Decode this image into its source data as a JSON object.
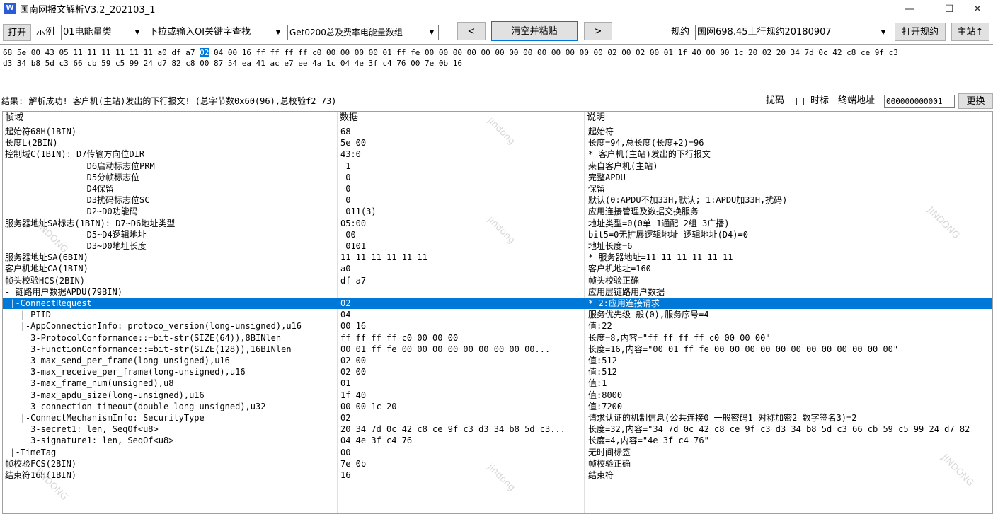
{
  "window": {
    "title": "国南网报文解析V3.2_202103_1",
    "icon": "app-logo-icon",
    "minimize_glyph": "—",
    "maximize_glyph": "☐",
    "close_glyph": "✕"
  },
  "toolbar": {
    "open_label": "打开",
    "example_label": "示例",
    "example_value": "01电能量类",
    "oi_value": "下拉或输入OI关键字查找",
    "get_value": "Get0200总及费率电能量数组",
    "prev_label": "<",
    "clear_paste_label": "清空并粘贴",
    "next_label": ">",
    "protocol_label": "规约",
    "protocol_value": "国网698.45上行规约20180907",
    "open_protocol_label": "打开规约",
    "master_label": "主站↑",
    "dropdown_glyph": "▼"
  },
  "hex": {
    "line1_pre": "68 5e 00 43 05 11 11 11 11 11 11 a0 df a7 ",
    "line1_sel": "02",
    "line1_post": " 04 00 16 ff ff ff ff c0 00 00 00 00 01 ff fe 00 00 00 00 00 00 00 00 00 00 00 00 00 02 00 02 00 01 1f 40 00 00 1c 20 02 20 34 7d 0c 42 c8 ce 9f c3",
    "line2": "d3 34 b8 5d c3 66 cb 59 c5 99 24 d7 82 c8 00 87 54 ea 41 ac e7 ee 4a 1c 04 4e 3f c4 76 00 7e 0b 16"
  },
  "result": {
    "text": "结果: 解析成功! 客户机(主站)发出的下行报文! (总字节数0x60(96),总校验f2 73)",
    "scramble_label": "扰码",
    "timetag_label": "时标",
    "terminal_addr_label": "终端地址",
    "terminal_addr_value": "000000000001",
    "change_label": "更换"
  },
  "table": {
    "headers": [
      "帧域",
      "数据",
      "说明"
    ],
    "selected_index": 15,
    "rows": [
      [
        "起始符68H(1BIN)",
        "68",
        "起始符"
      ],
      [
        "长度L(2BIN)",
        "5e 00",
        "长度=94,总长度(长度+2)=96"
      ],
      [
        "控制域C(1BIN): D7传输方向位DIR",
        "43:0",
        "* 客户机(主站)发出的下行报文"
      ],
      [
        "                D6启动标志位PRM",
        " 1",
        "来自客户机(主站)"
      ],
      [
        "                D5分帧标志位",
        " 0",
        "完整APDU"
      ],
      [
        "                D4保留",
        " 0",
        "保留"
      ],
      [
        "                D3扰码标志位SC",
        " 0",
        "默认(0:APDU不加33H,默认; 1:APDU加33H,扰码)"
      ],
      [
        "                D2~D0功能码",
        " 011(3)",
        "应用连接管理及数据交换服务"
      ],
      [
        "服务器地址SA标志(1BIN): D7~D6地址类型",
        "05:00",
        "地址类型=0(0单 1通配 2组 3广播)"
      ],
      [
        "                D5~D4逻辑地址",
        " 00",
        "bit5=0无扩展逻辑地址 逻辑地址(D4)=0"
      ],
      [
        "                D3~D0地址长度",
        " 0101",
        "地址长度=6"
      ],
      [
        "服务器地址SA(6BIN)",
        "11 11 11 11 11 11",
        "* 服务器地址=11 11 11 11 11 11"
      ],
      [
        "客户机地址CA(1BIN)",
        "a0",
        "客户机地址=160"
      ],
      [
        "帧头校验HCS(2BIN)",
        "df a7",
        "帧头校验正确"
      ],
      [
        "- 链路用户数据APDU(79BIN)",
        "",
        "应用层链路用户数据"
      ],
      [
        " |-ConnectRequest",
        "02",
        "* 2:应用连接请求"
      ],
      [
        "   |-PIID",
        "04",
        "服务优先级—般(0),服务序号=4"
      ],
      [
        "   |-AppConnectionInfo: protoco_version(long-unsigned),u16",
        "00 16",
        "值:22"
      ],
      [
        "     3-ProtocolConformance::=bit-str(SIZE(64)),8BINlen",
        "ff ff ff ff c0 00 00 00",
        "长度=8,内容=\"ff ff ff ff c0 00 00 00\""
      ],
      [
        "     3-FunctionConformance::=bit-str(SIZE(128)),16BINlen",
        "00 01 ff fe 00 00 00 00 00 00 00 00 00...",
        "长度=16,内容=\"00 01 ff fe 00 00 00 00 00 00 00 00 00 00 00 00\""
      ],
      [
        "     3-max_send_per_frame(long-unsigned),u16",
        "02 00",
        "值:512"
      ],
      [
        "     3-max_receive_per_frame(long-unsigned),u16",
        "02 00",
        "值:512"
      ],
      [
        "     3-max_frame_num(unsigned),u8",
        "01",
        "值:1"
      ],
      [
        "     3-max_apdu_size(long-unsigned),u16",
        "1f 40",
        "值:8000"
      ],
      [
        "     3-connection_timeout(double-long-unsigned),u32",
        "00 00 1c 20",
        "值:7200"
      ],
      [
        "   |-ConnectMechanismInfo: SecurityType",
        "02",
        "请求认证的机制信息(公共连接0 一般密码1 对称加密2 数字签名3)=2"
      ],
      [
        "     3-secret1: len, SeqOf<u8>",
        "20 34 7d 0c 42 c8 ce 9f c3 d3 34 b8 5d c3...",
        "长度=32,内容=\"34 7d 0c 42 c8 ce 9f c3 d3 34 b8 5d c3 66 cb 59 c5 99 24 d7 82"
      ],
      [
        "     3-signature1: len, SeqOf<u8>",
        "04 4e 3f c4 76",
        "长度=4,内容=\"4e 3f c4 76\""
      ],
      [
        " |-TimeTag",
        "00",
        "无时间标签"
      ],
      [
        "帧校验FCS(2BIN)",
        "7e 0b",
        "帧校验正确"
      ],
      [
        "结束符16H(1BIN)",
        "16",
        "结束符"
      ]
    ]
  },
  "watermark": [
    "jindong",
    "JINDONG"
  ]
}
